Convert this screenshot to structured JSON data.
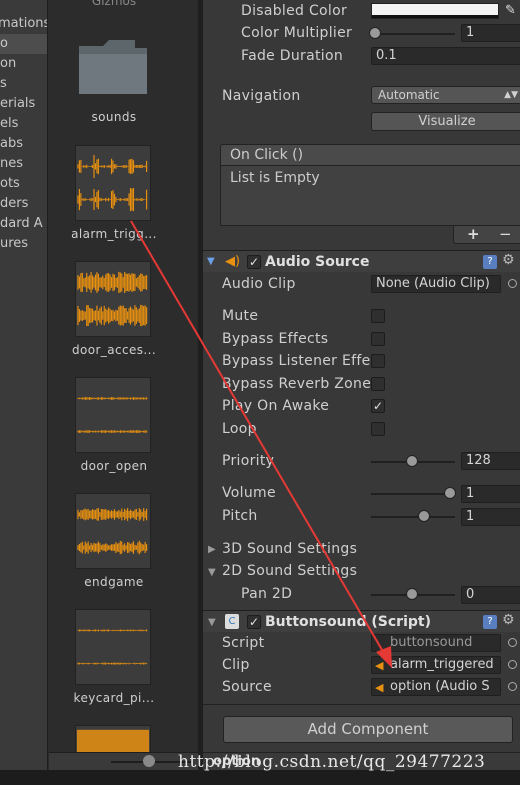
{
  "tree": {
    "items": [
      "mations",
      "o",
      "on",
      "s",
      "erials",
      "els",
      "abs",
      "nes",
      "ots",
      "ders",
      "dard A",
      "ures"
    ]
  },
  "assets": {
    "top_label": "Gizmos",
    "items": [
      {
        "label": "sounds",
        "kind": "folder"
      },
      {
        "label": "alarm_trigg...",
        "kind": "audio"
      },
      {
        "label": "door_acces...",
        "kind": "audio"
      },
      {
        "label": "door_open",
        "kind": "audio"
      },
      {
        "label": "endgame",
        "kind": "audio"
      },
      {
        "label": "keycard_pi...",
        "kind": "audio"
      }
    ],
    "waveform_color": "#e8900f"
  },
  "button_component": {
    "disabled_color_label": "Disabled Color",
    "color_multiplier_label": "Color Multiplier",
    "color_multiplier_value": "1",
    "fade_duration_label": "Fade Duration",
    "fade_duration_value": "0.1",
    "navigation_label": "Navigation",
    "navigation_value": "Automatic",
    "visualize_label": "Visualize",
    "onclick_header": "On Click ()",
    "onclick_empty": "List is Empty",
    "plus_label": "+",
    "minus_label": "−"
  },
  "audio_source": {
    "title": "Audio Source",
    "audio_clip_label": "Audio Clip",
    "audio_clip_value": "None (Audio Clip)",
    "mute_label": "Mute",
    "bypass_effects_label": "Bypass Effects",
    "bypass_listener_label": "Bypass Listener Effe",
    "bypass_reverb_label": "Bypass Reverb Zone",
    "play_on_awake_label": "Play On Awake",
    "loop_label": "Loop",
    "priority_label": "Priority",
    "priority_value": "128",
    "volume_label": "Volume",
    "volume_value": "1",
    "pitch_label": "Pitch",
    "pitch_value": "1",
    "sound3d_label": "3D Sound Settings",
    "sound2d_label": "2D Sound Settings",
    "pan2d_label": "Pan 2D",
    "pan2d_value": "0"
  },
  "buttonsound_script": {
    "title": "Buttonsound (Script)",
    "script_label": "Script",
    "script_value": "buttonsound",
    "clip_label": "Clip",
    "clip_value": "alarm_triggered",
    "source_label": "Source",
    "source_value": "option (Audio S"
  },
  "add_component_label": "Add Component",
  "footer_label": "option",
  "watermark": "http://blog.csdn.net/qq_29477223",
  "colors": {
    "accent": "#e8900f",
    "arrow": "#e53935",
    "panel": "#383838"
  }
}
